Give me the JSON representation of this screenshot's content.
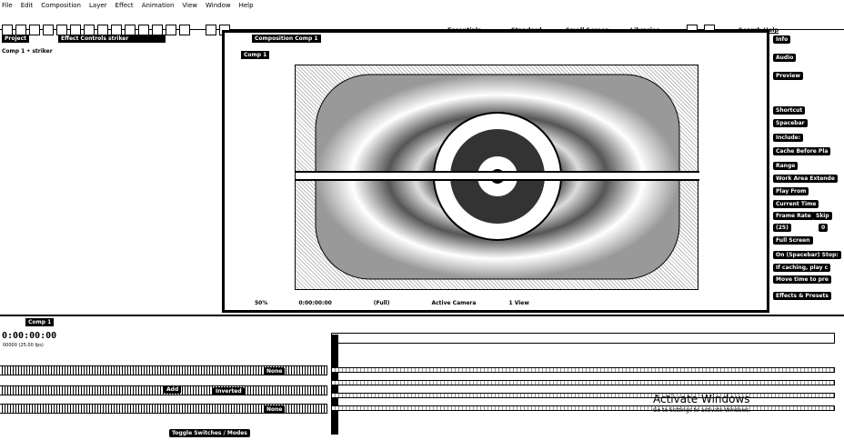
{
  "menu": [
    "File",
    "Edit",
    "Composition",
    "Layer",
    "Effect",
    "Animation",
    "View",
    "Window",
    "Help"
  ],
  "workspaces": {
    "essentials": "Essentials",
    "standard": "Standard",
    "small_screen": "Small Screen",
    "libraries": "Libraries",
    "search": "Search Help"
  },
  "project_panel": {
    "tab_project": "Project",
    "tab_effect_controls": "Effect Controls striker",
    "breadcrumb": "Comp 1 • striker"
  },
  "comp_panel": {
    "tab": "Composition Comp 1",
    "crumb": "Comp 1",
    "zoom": "50%",
    "timecode": "0:00:00:00",
    "resolution": "(Full)",
    "camera": "Active Camera",
    "views": "1 View"
  },
  "right_panel": {
    "info": "Info",
    "audio": "Audio",
    "preview": "Preview",
    "shortcut": "Shortcut",
    "spacebar": "Spacebar",
    "include": "Include:",
    "cache": "Cache Before Pla",
    "range": "Range",
    "work_area": "Work Area Extende",
    "play_from": "Play From",
    "current_time": "Current Time",
    "frame_rate": "Frame Rate",
    "skip": "Skip",
    "fr_value": "(25)",
    "skip_value": "0",
    "full_screen": "Full Screen",
    "on_stop": "On (Spacebar) Stop:",
    "if_caching": "If caching, play c",
    "move_time": "Move time to pre",
    "effects_presets": "Effects & Presets"
  },
  "timeline": {
    "tab": "Comp 1",
    "timecode": "0:00:00:00",
    "fps": "00000 (25.00 fps)",
    "toggle": "Toggle Switches / Modes",
    "none1": "None",
    "none2": "None",
    "add": "Add",
    "inverted": "Inverted"
  },
  "watermark": {
    "line1": "Activate Windows",
    "line2": "Go to Settings to activate Windows."
  }
}
